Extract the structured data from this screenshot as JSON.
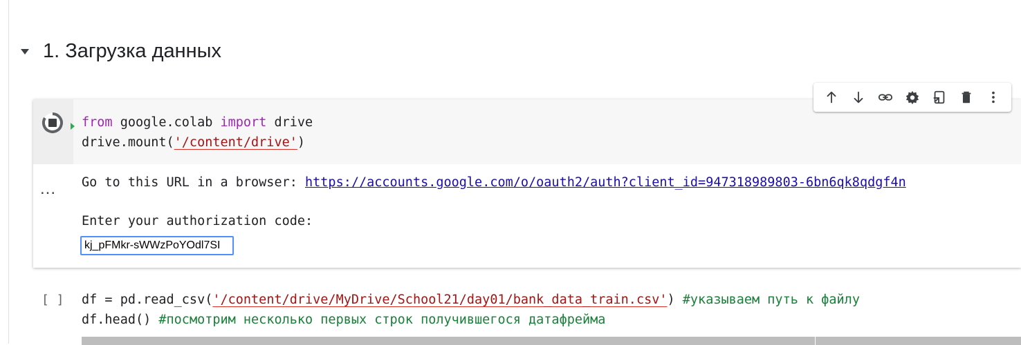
{
  "section": {
    "title": "1. Загрузка данных"
  },
  "toolbar": {
    "icons": [
      "arrow-up-icon",
      "arrow-down-icon",
      "link-icon",
      "gear-icon",
      "mirror-cell-icon",
      "trash-icon",
      "more-vert-icon"
    ]
  },
  "cell1": {
    "code_line1": {
      "kw1": "from",
      "mod": " google.colab ",
      "kw2": "import",
      "rest": " drive"
    },
    "code_line2": {
      "pre": "drive.mount(",
      "str": "'/content/drive'",
      "post": ")"
    },
    "output_marker": "...",
    "output_text": "Go to this URL in a browser: ",
    "output_link": "https://accounts.google.com/o/oauth2/auth?client_id=947318989803-6bn6qk8qdgf4n",
    "prompt_text": "Enter your authorization code:",
    "auth_code_value": "kj_pFMkr-sWWzPoYOdl7SI"
  },
  "cell2": {
    "bracket": "[ ]",
    "line1": {
      "pre": "df = pd.read_csv(",
      "str": "'/content/drive/MyDrive/School21/day01/bank_data_train.csv'",
      "post": ") ",
      "comment": "#указываем путь к файлу"
    },
    "line2": {
      "pre": "df.head() ",
      "comment": "#посмотрим несколько первых строк получившегося датафрейма"
    }
  },
  "colors": {
    "keyword": "#9c27b0",
    "string": "#a31515",
    "comment": "#188038",
    "link": "#1a0dab",
    "focus": "#4d90fe"
  }
}
